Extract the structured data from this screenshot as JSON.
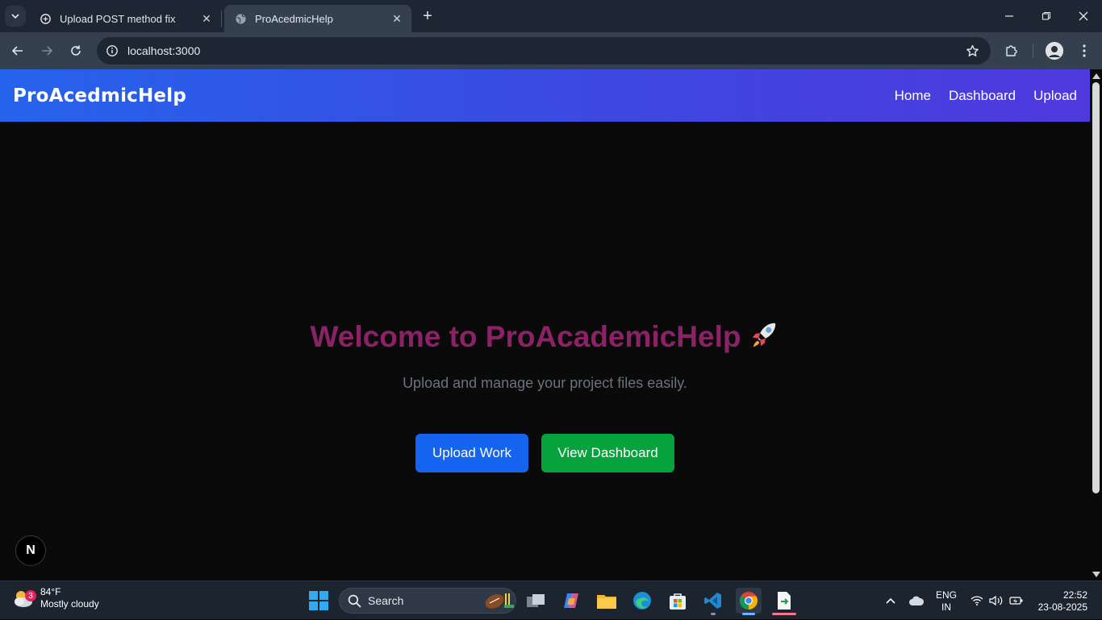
{
  "browser": {
    "tabs": [
      {
        "title": "Upload POST method fix",
        "active": false,
        "icon": "chatgpt-icon"
      },
      {
        "title": "ProAcedmicHelp",
        "active": true,
        "icon": "globe-icon"
      }
    ],
    "url": "localhost:3000"
  },
  "page": {
    "brand": "ProAcedmicHelp",
    "nav": [
      "Home",
      "Dashboard",
      "Upload"
    ],
    "hero": {
      "title": "Welcome to ProAcademicHelp",
      "subtitle": "Upload and manage your project files easily.",
      "primary_button": "Upload Work",
      "secondary_button": "View Dashboard"
    },
    "dev_badge": "N",
    "colors": {
      "title": "#8b2266",
      "primary_button": "#1564f0",
      "secondary_button": "#06a33c",
      "navbar_start": "#2563eb",
      "navbar_end": "#4f39dd"
    }
  },
  "taskbar": {
    "weather": {
      "temp": "84°F",
      "condition": "Mostly cloudy",
      "badge": "3"
    },
    "search_label": "Search",
    "language": {
      "line1": "ENG",
      "line2": "IN"
    },
    "clock": {
      "time": "22:52",
      "date": "23-08-2025"
    }
  }
}
